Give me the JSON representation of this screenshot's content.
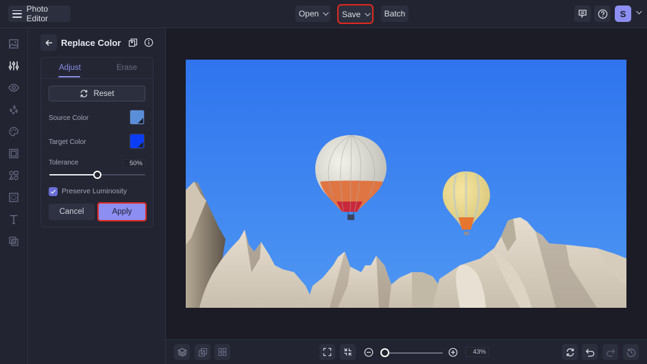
{
  "app": {
    "title": "Photo Editor"
  },
  "toolbar": {
    "open_label": "Open",
    "save_label": "Save",
    "batch_label": "Batch",
    "avatar_initial": "S"
  },
  "sidebar": {
    "items": [
      {
        "name": "image",
        "active": false
      },
      {
        "name": "adjust",
        "active": true
      },
      {
        "name": "effects",
        "active": false
      },
      {
        "name": "artsy",
        "active": false
      },
      {
        "name": "paint",
        "active": false
      },
      {
        "name": "frames",
        "active": false
      },
      {
        "name": "graphics",
        "active": false
      },
      {
        "name": "overlays",
        "active": false
      },
      {
        "name": "text",
        "active": false
      },
      {
        "name": "textures",
        "active": false
      }
    ]
  },
  "panel": {
    "title": "Replace Color",
    "tabs": [
      {
        "label": "Adjust",
        "active": true
      },
      {
        "label": "Erase",
        "active": false
      }
    ],
    "reset_label": "Reset",
    "source_color_label": "Source Color",
    "source_color": "#5b8ed9",
    "target_color_label": "Target Color",
    "target_color": "#0a3df5",
    "tolerance_label": "Tolerance",
    "tolerance_value": "50%",
    "tolerance_fraction": 0.5,
    "preserve_luminosity_label": "Preserve Luminosity",
    "preserve_luminosity_checked": true,
    "cancel_label": "Cancel",
    "apply_label": "Apply"
  },
  "canvas": {
    "image_description": "Hot air balloons over Cappadocia rock formations with blue sky",
    "sky_color": "#2f7cf0"
  },
  "bottombar": {
    "zoom_value": "43%",
    "zoom_fraction": 0.1
  },
  "colors": {
    "accent": "#8c8ef2",
    "highlight": "#e02a1f"
  }
}
